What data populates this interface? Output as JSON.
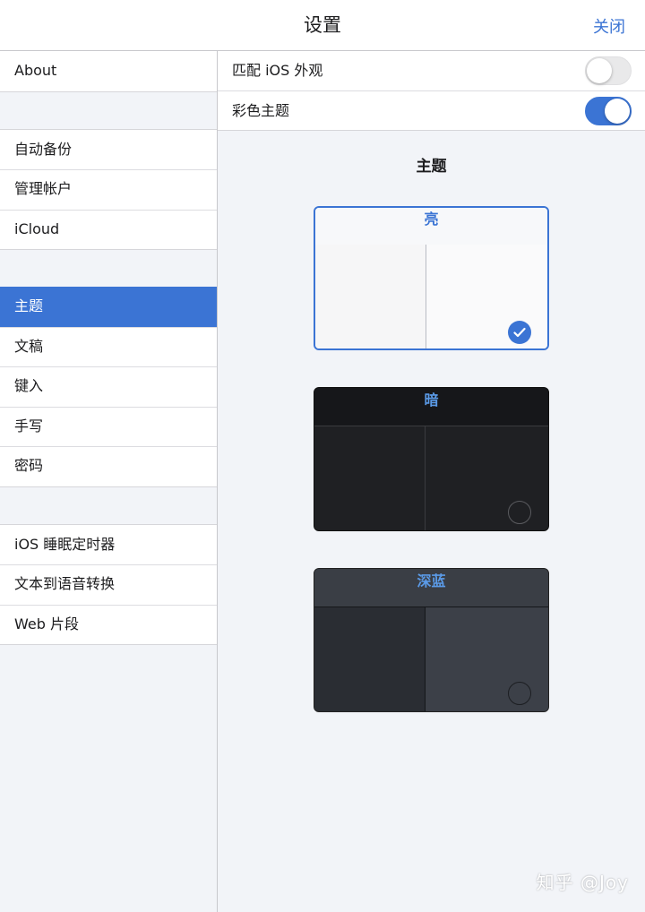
{
  "header": {
    "title": "设置",
    "close_label": "关闭"
  },
  "sidebar": {
    "groups": [
      {
        "items": [
          {
            "label": "About"
          }
        ]
      },
      {
        "items": [
          {
            "label": "自动备份"
          },
          {
            "label": "管理帐户"
          },
          {
            "label": "iCloud"
          }
        ]
      },
      {
        "items": [
          {
            "label": "主题",
            "selected": true
          },
          {
            "label": "文稿"
          },
          {
            "label": "键入"
          },
          {
            "label": "手写"
          },
          {
            "label": "密码"
          }
        ]
      },
      {
        "items": [
          {
            "label": "iOS 睡眠定时器"
          },
          {
            "label": "文本到语音转换"
          },
          {
            "label": "Web 片段"
          }
        ]
      }
    ]
  },
  "main": {
    "toggles": [
      {
        "label": "匹配 iOS 外观",
        "on": false
      },
      {
        "label": "彩色主题",
        "on": true
      }
    ],
    "section_title": "主题",
    "themes": [
      {
        "label": "亮",
        "selected": true
      },
      {
        "label": "暗",
        "selected": false
      },
      {
        "label": "深蓝",
        "selected": false
      }
    ]
  },
  "watermark": "知乎 @Joy",
  "colors": {
    "accent": "#3b74d4",
    "background": "#f2f4f8"
  }
}
